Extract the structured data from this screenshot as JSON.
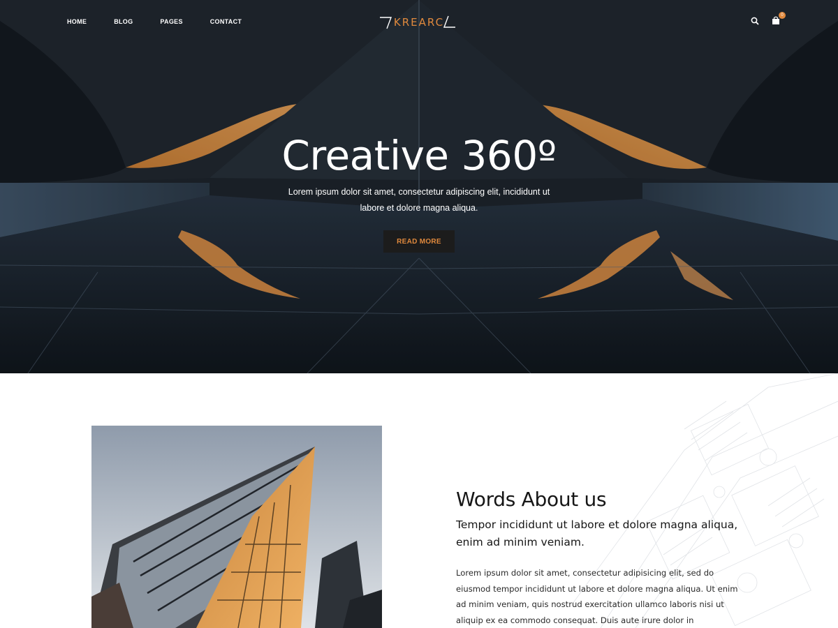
{
  "header": {
    "nav": [
      "HOME",
      "BLOG",
      "PAGES",
      "CONTACT"
    ],
    "logo_text": "KREARC",
    "cart_count": "0"
  },
  "hero": {
    "title": "Creative 360º",
    "subtitle": "Lorem ipsum dolor sit amet, consectetur adipiscing elit, incididunt ut labore et dolore magna aliqua.",
    "button_label": "READ MORE"
  },
  "about": {
    "title": "Words About us",
    "lead": "Tempor incididunt ut labore et dolore magna aliqua, enim ad minim veniam.",
    "body": "Lorem ipsum dolor sit amet, consectetur adipisicing elit, sed do eiusmod tempor incididunt ut labore et dolore magna aliqua. Ut enim ad minim veniam, quis nostrud exercitation ullamco laboris nisi ut aliquip ex ea commodo consequat. Duis aute irure dolor in reprehenderit in voluptate"
  },
  "colors": {
    "accent": "#e0893d",
    "dark": "#1c1c1c",
    "hero_bg": "#1b2129"
  },
  "icons": {
    "search": "search-icon",
    "cart": "shopping-bag-icon",
    "logo": "logo-mark-icon"
  }
}
